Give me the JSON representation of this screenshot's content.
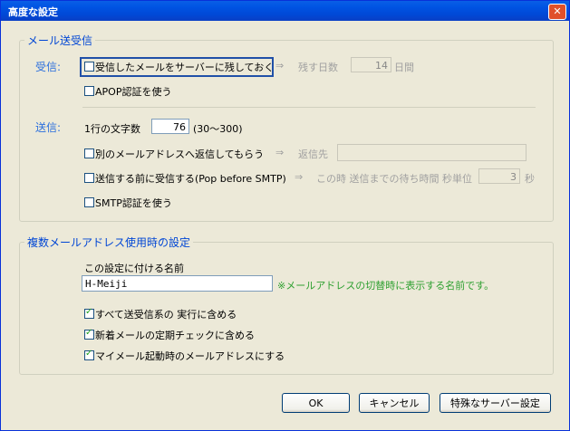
{
  "window": {
    "title": "高度な設定",
    "close_glyph": "✕"
  },
  "mail": {
    "legend": "メール送受信",
    "receive_label": "受信:",
    "keep_on_server": "受信したメールをサーバーに残しておく",
    "arrow": "⇒",
    "keep_days_label": "残す日数",
    "keep_days_value": "14",
    "days_unit": "日間",
    "apop": "APOP認証を使う",
    "send_label": "送信:",
    "chars_per_line_label": "1行の文字数",
    "chars_per_line_value": "76",
    "chars_range": "(30〜300)",
    "reply_to": "別のメールアドレスへ返信してもらう",
    "reply_to_label": "返信先",
    "pop_before_smtp": "送信する前に受信する(Pop before SMTP)",
    "wait_label": "この時 送信までの待ち時間 秒単位",
    "wait_value": "3",
    "sec_unit": "秒",
    "smtp_auth": "SMTP認証を使う"
  },
  "multi": {
    "legend": "複数メールアドレス使用時の設定",
    "name_label": "この設定に付ける名前",
    "name_value": "H-Meiji",
    "hint": "※メールアドレスの切替時に表示する名前です。",
    "include_send_recv": "すべて送受信系の 実行に含める",
    "include_periodic": "新着メールの定期チェックに含める",
    "use_at_startup": "マイメール起動時のメールアドレスにする"
  },
  "buttons": {
    "ok": "OK",
    "cancel": "キャンセル",
    "special_server": "特殊なサーバー設定"
  }
}
